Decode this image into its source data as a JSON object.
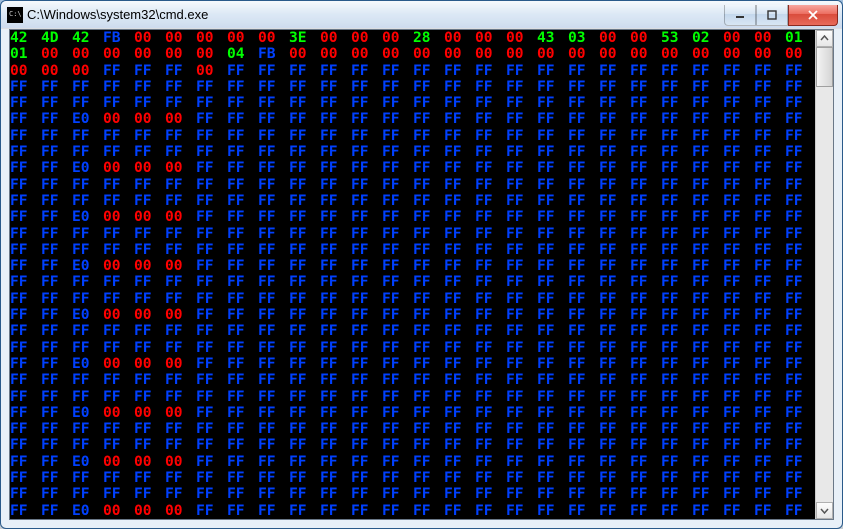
{
  "window": {
    "title": "C:\\Windows\\system32\\cmd.exe",
    "icon": "cmd-icon"
  },
  "controls": {
    "minimize_label": "Minimize",
    "maximize_label": "Maximize",
    "close_label": "Close"
  },
  "hex": {
    "columns": 32,
    "rows": [
      [
        "g:42",
        "g:4D",
        "g:42",
        "b:FB",
        "r:00",
        "r:00",
        "r:00",
        "r:00",
        "r:00",
        "g:3E",
        "r:00",
        "r:00",
        "r:00",
        "g:28",
        "r:00",
        "r:00",
        "r:00",
        "g:43",
        "g:03",
        "r:00",
        "r:00",
        "g:53",
        "g:02",
        "r:00",
        "r:00",
        "g:01"
      ],
      [
        "g:01",
        "r:00",
        "r:00",
        "r:00",
        "r:00",
        "r:00",
        "r:00",
        "g:04",
        "b:FB",
        "r:00",
        "r:00",
        "r:00",
        "r:00",
        "r:00",
        "r:00",
        "r:00",
        "r:00",
        "r:00",
        "r:00",
        "r:00",
        "r:00",
        "r:00",
        "r:00",
        "r:00",
        "r:00",
        "r:00"
      ],
      [
        "r:00",
        "r:00",
        "r:00",
        "b:FF",
        "b:FF",
        "b:FF",
        "r:00",
        "b:FF",
        "b:FF",
        "b:FF",
        "b:FF",
        "b:FF",
        "b:FF",
        "b:FF",
        "b:FF",
        "b:FF",
        "b:FF",
        "b:FF",
        "b:FF",
        "b:FF",
        "b:FF",
        "b:FF",
        "b:FF",
        "b:FF",
        "b:FF",
        "b:FF"
      ],
      [
        "b:FF",
        "b:FF",
        "b:FF",
        "b:FF",
        "b:FF",
        "b:FF",
        "b:FF",
        "b:FF",
        "b:FF",
        "b:FF",
        "b:FF",
        "b:FF",
        "b:FF",
        "b:FF",
        "b:FF",
        "b:FF",
        "b:FF",
        "b:FF",
        "b:FF",
        "b:FF",
        "b:FF",
        "b:FF",
        "b:FF",
        "b:FF",
        "b:FF",
        "b:FF"
      ],
      [
        "b:FF",
        "b:FF",
        "b:FF",
        "b:FF",
        "b:FF",
        "b:FF",
        "b:FF",
        "b:FF",
        "b:FF",
        "b:FF",
        "b:FF",
        "b:FF",
        "b:FF",
        "b:FF",
        "b:FF",
        "b:FF",
        "b:FF",
        "b:FF",
        "b:FF",
        "b:FF",
        "b:FF",
        "b:FF",
        "b:FF",
        "b:FF",
        "b:FF",
        "b:FF"
      ],
      [
        "b:FF",
        "b:FF",
        "b:E0",
        "r:00",
        "r:00",
        "r:00",
        "b:FF",
        "b:FF",
        "b:FF",
        "b:FF",
        "b:FF",
        "b:FF",
        "b:FF",
        "b:FF",
        "b:FF",
        "b:FF",
        "b:FF",
        "b:FF",
        "b:FF",
        "b:FF",
        "b:FF",
        "b:FF",
        "b:FF",
        "b:FF",
        "b:FF",
        "b:FF"
      ],
      [
        "b:FF",
        "b:FF",
        "b:FF",
        "b:FF",
        "b:FF",
        "b:FF",
        "b:FF",
        "b:FF",
        "b:FF",
        "b:FF",
        "b:FF",
        "b:FF",
        "b:FF",
        "b:FF",
        "b:FF",
        "b:FF",
        "b:FF",
        "b:FF",
        "b:FF",
        "b:FF",
        "b:FF",
        "b:FF",
        "b:FF",
        "b:FF",
        "b:FF",
        "b:FF"
      ],
      [
        "b:FF",
        "b:FF",
        "b:FF",
        "b:FF",
        "b:FF",
        "b:FF",
        "b:FF",
        "b:FF",
        "b:FF",
        "b:FF",
        "b:FF",
        "b:FF",
        "b:FF",
        "b:FF",
        "b:FF",
        "b:FF",
        "b:FF",
        "b:FF",
        "b:FF",
        "b:FF",
        "b:FF",
        "b:FF",
        "b:FF",
        "b:FF",
        "b:FF",
        "b:FF"
      ],
      [
        "b:FF",
        "b:FF",
        "b:E0",
        "r:00",
        "r:00",
        "r:00",
        "b:FF",
        "b:FF",
        "b:FF",
        "b:FF",
        "b:FF",
        "b:FF",
        "b:FF",
        "b:FF",
        "b:FF",
        "b:FF",
        "b:FF",
        "b:FF",
        "b:FF",
        "b:FF",
        "b:FF",
        "b:FF",
        "b:FF",
        "b:FF",
        "b:FF",
        "b:FF"
      ],
      [
        "b:FF",
        "b:FF",
        "b:FF",
        "b:FF",
        "b:FF",
        "b:FF",
        "b:FF",
        "b:FF",
        "b:FF",
        "b:FF",
        "b:FF",
        "b:FF",
        "b:FF",
        "b:FF",
        "b:FF",
        "b:FF",
        "b:FF",
        "b:FF",
        "b:FF",
        "b:FF",
        "b:FF",
        "b:FF",
        "b:FF",
        "b:FF",
        "b:FF",
        "b:FF"
      ],
      [
        "b:FF",
        "b:FF",
        "b:FF",
        "b:FF",
        "b:FF",
        "b:FF",
        "b:FF",
        "b:FF",
        "b:FF",
        "b:FF",
        "b:FF",
        "b:FF",
        "b:FF",
        "b:FF",
        "b:FF",
        "b:FF",
        "b:FF",
        "b:FF",
        "b:FF",
        "b:FF",
        "b:FF",
        "b:FF",
        "b:FF",
        "b:FF",
        "b:FF",
        "b:FF"
      ],
      [
        "b:FF",
        "b:FF",
        "b:E0",
        "r:00",
        "r:00",
        "r:00",
        "b:FF",
        "b:FF",
        "b:FF",
        "b:FF",
        "b:FF",
        "b:FF",
        "b:FF",
        "b:FF",
        "b:FF",
        "b:FF",
        "b:FF",
        "b:FF",
        "b:FF",
        "b:FF",
        "b:FF",
        "b:FF",
        "b:FF",
        "b:FF",
        "b:FF",
        "b:FF"
      ],
      [
        "b:FF",
        "b:FF",
        "b:FF",
        "b:FF",
        "b:FF",
        "b:FF",
        "b:FF",
        "b:FF",
        "b:FF",
        "b:FF",
        "b:FF",
        "b:FF",
        "b:FF",
        "b:FF",
        "b:FF",
        "b:FF",
        "b:FF",
        "b:FF",
        "b:FF",
        "b:FF",
        "b:FF",
        "b:FF",
        "b:FF",
        "b:FF",
        "b:FF",
        "b:FF"
      ],
      [
        "b:FF",
        "b:FF",
        "b:FF",
        "b:FF",
        "b:FF",
        "b:FF",
        "b:FF",
        "b:FF",
        "b:FF",
        "b:FF",
        "b:FF",
        "b:FF",
        "b:FF",
        "b:FF",
        "b:FF",
        "b:FF",
        "b:FF",
        "b:FF",
        "b:FF",
        "b:FF",
        "b:FF",
        "b:FF",
        "b:FF",
        "b:FF",
        "b:FF",
        "b:FF"
      ],
      [
        "b:FF",
        "b:FF",
        "b:E0",
        "r:00",
        "r:00",
        "r:00",
        "b:FF",
        "b:FF",
        "b:FF",
        "b:FF",
        "b:FF",
        "b:FF",
        "b:FF",
        "b:FF",
        "b:FF",
        "b:FF",
        "b:FF",
        "b:FF",
        "b:FF",
        "b:FF",
        "b:FF",
        "b:FF",
        "b:FF",
        "b:FF",
        "b:FF",
        "b:FF"
      ],
      [
        "b:FF",
        "b:FF",
        "b:FF",
        "b:FF",
        "b:FF",
        "b:FF",
        "b:FF",
        "b:FF",
        "b:FF",
        "b:FF",
        "b:FF",
        "b:FF",
        "b:FF",
        "b:FF",
        "b:FF",
        "b:FF",
        "b:FF",
        "b:FF",
        "b:FF",
        "b:FF",
        "b:FF",
        "b:FF",
        "b:FF",
        "b:FF",
        "b:FF",
        "b:FF"
      ],
      [
        "b:FF",
        "b:FF",
        "b:FF",
        "b:FF",
        "b:FF",
        "b:FF",
        "b:FF",
        "b:FF",
        "b:FF",
        "b:FF",
        "b:FF",
        "b:FF",
        "b:FF",
        "b:FF",
        "b:FF",
        "b:FF",
        "b:FF",
        "b:FF",
        "b:FF",
        "b:FF",
        "b:FF",
        "b:FF",
        "b:FF",
        "b:FF",
        "b:FF",
        "b:FF"
      ],
      [
        "b:FF",
        "b:FF",
        "b:E0",
        "r:00",
        "r:00",
        "r:00",
        "b:FF",
        "b:FF",
        "b:FF",
        "b:FF",
        "b:FF",
        "b:FF",
        "b:FF",
        "b:FF",
        "b:FF",
        "b:FF",
        "b:FF",
        "b:FF",
        "b:FF",
        "b:FF",
        "b:FF",
        "b:FF",
        "b:FF",
        "b:FF",
        "b:FF",
        "b:FF"
      ],
      [
        "b:FF",
        "b:FF",
        "b:FF",
        "b:FF",
        "b:FF",
        "b:FF",
        "b:FF",
        "b:FF",
        "b:FF",
        "b:FF",
        "b:FF",
        "b:FF",
        "b:FF",
        "b:FF",
        "b:FF",
        "b:FF",
        "b:FF",
        "b:FF",
        "b:FF",
        "b:FF",
        "b:FF",
        "b:FF",
        "b:FF",
        "b:FF",
        "b:FF",
        "b:FF"
      ],
      [
        "b:FF",
        "b:FF",
        "b:FF",
        "b:FF",
        "b:FF",
        "b:FF",
        "b:FF",
        "b:FF",
        "b:FF",
        "b:FF",
        "b:FF",
        "b:FF",
        "b:FF",
        "b:FF",
        "b:FF",
        "b:FF",
        "b:FF",
        "b:FF",
        "b:FF",
        "b:FF",
        "b:FF",
        "b:FF",
        "b:FF",
        "b:FF",
        "b:FF",
        "b:FF"
      ],
      [
        "b:FF",
        "b:FF",
        "b:E0",
        "r:00",
        "r:00",
        "r:00",
        "b:FF",
        "b:FF",
        "b:FF",
        "b:FF",
        "b:FF",
        "b:FF",
        "b:FF",
        "b:FF",
        "b:FF",
        "b:FF",
        "b:FF",
        "b:FF",
        "b:FF",
        "b:FF",
        "b:FF",
        "b:FF",
        "b:FF",
        "b:FF",
        "b:FF",
        "b:FF"
      ],
      [
        "b:FF",
        "b:FF",
        "b:FF",
        "b:FF",
        "b:FF",
        "b:FF",
        "b:FF",
        "b:FF",
        "b:FF",
        "b:FF",
        "b:FF",
        "b:FF",
        "b:FF",
        "b:FF",
        "b:FF",
        "b:FF",
        "b:FF",
        "b:FF",
        "b:FF",
        "b:FF",
        "b:FF",
        "b:FF",
        "b:FF",
        "b:FF",
        "b:FF",
        "b:FF"
      ],
      [
        "b:FF",
        "b:FF",
        "b:FF",
        "b:FF",
        "b:FF",
        "b:FF",
        "b:FF",
        "b:FF",
        "b:FF",
        "b:FF",
        "b:FF",
        "b:FF",
        "b:FF",
        "b:FF",
        "b:FF",
        "b:FF",
        "b:FF",
        "b:FF",
        "b:FF",
        "b:FF",
        "b:FF",
        "b:FF",
        "b:FF",
        "b:FF",
        "b:FF",
        "b:FF"
      ],
      [
        "b:FF",
        "b:FF",
        "b:E0",
        "r:00",
        "r:00",
        "r:00",
        "b:FF",
        "b:FF",
        "b:FF",
        "b:FF",
        "b:FF",
        "b:FF",
        "b:FF",
        "b:FF",
        "b:FF",
        "b:FF",
        "b:FF",
        "b:FF",
        "b:FF",
        "b:FF",
        "b:FF",
        "b:FF",
        "b:FF",
        "b:FF",
        "b:FF",
        "b:FF"
      ],
      [
        "b:FF",
        "b:FF",
        "b:FF",
        "b:FF",
        "b:FF",
        "b:FF",
        "b:FF",
        "b:FF",
        "b:FF",
        "b:FF",
        "b:FF",
        "b:FF",
        "b:FF",
        "b:FF",
        "b:FF",
        "b:FF",
        "b:FF",
        "b:FF",
        "b:FF",
        "b:FF",
        "b:FF",
        "b:FF",
        "b:FF",
        "b:FF",
        "b:FF",
        "b:FF"
      ],
      [
        "b:FF",
        "b:FF",
        "b:FF",
        "b:FF",
        "b:FF",
        "b:FF",
        "b:FF",
        "b:FF",
        "b:FF",
        "b:FF",
        "b:FF",
        "b:FF",
        "b:FF",
        "b:FF",
        "b:FF",
        "b:FF",
        "b:FF",
        "b:FF",
        "b:FF",
        "b:FF",
        "b:FF",
        "b:FF",
        "b:FF",
        "b:FF",
        "b:FF",
        "b:FF"
      ],
      [
        "b:FF",
        "b:FF",
        "b:E0",
        "r:00",
        "r:00",
        "r:00",
        "b:FF",
        "b:FF",
        "b:FF",
        "b:FF",
        "b:FF",
        "b:FF",
        "b:FF",
        "b:FF",
        "b:FF",
        "b:FF",
        "b:FF",
        "b:FF",
        "b:FF",
        "b:FF",
        "b:FF",
        "b:FF",
        "b:FF",
        "b:FF",
        "b:FF",
        "b:FF"
      ],
      [
        "b:FF",
        "b:FF",
        "b:FF",
        "b:FF",
        "b:FF",
        "b:FF",
        "b:FF",
        "b:FF",
        "b:FF",
        "b:FF",
        "b:FF",
        "b:FF",
        "b:FF",
        "b:FF",
        "b:FF",
        "b:FF",
        "b:FF",
        "b:FF",
        "b:FF",
        "b:FF",
        "b:FF",
        "b:FF",
        "b:FF",
        "b:FF",
        "b:FF",
        "b:FF"
      ],
      [
        "b:FF",
        "b:FF",
        "b:FF",
        "b:FF",
        "b:FF",
        "b:FF",
        "b:FF",
        "b:FF",
        "b:FF",
        "b:FF",
        "b:FF",
        "b:FF",
        "b:FF",
        "b:FF",
        "b:FF",
        "b:FF",
        "b:FF",
        "b:FF",
        "b:FF",
        "b:FF",
        "b:FF",
        "b:FF",
        "b:FF",
        "b:FF",
        "b:FF",
        "b:FF"
      ],
      [
        "b:FF",
        "b:FF",
        "b:E0",
        "r:00",
        "r:00",
        "r:00",
        "b:FF",
        "b:FF",
        "b:FF",
        "b:FF",
        "b:FF",
        "b:FF",
        "b:FF",
        "b:FF",
        "b:FF",
        "b:FF",
        "b:FF",
        "b:FF",
        "b:FF",
        "b:FF",
        "b:FF",
        "b:FF",
        "b:FF",
        "b:FF",
        "b:FF",
        "b:FF"
      ]
    ]
  }
}
